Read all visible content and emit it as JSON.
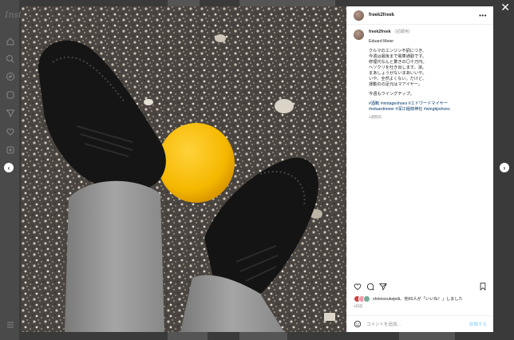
{
  "app": {
    "logo_text": "Inst"
  },
  "post": {
    "username": "freek2freek",
    "more_label": "•••",
    "caption": {
      "username": "freek2freek",
      "edited": "（記録用）",
      "lines": [
        "Eduard Meier",
        "",
        "クルマのエンジン不調につき、",
        "今週は最後まで電車通勤です。",
        "修理代なんと驚きの〇十万円。",
        "ヘソクリを吐き出します。涙。",
        "まあしょうがないまあいいや。",
        "いや、全然よくない。だけど、",
        "運動のの足元はマアイヤー。",
        "",
        "今週もウイングチップ。"
      ],
      "hashtags": [
        "#酒靴 #vintageshoes #エドワードマイヤー",
        "#eduardmeier #深江稲荷神社 #wingtipshoes"
      ],
      "time": "1週間前"
    },
    "likes_text": "shinnosukejedi、他60人が「いいね！」しました",
    "post_time": "3日前",
    "comment_placeholder": "コメントを追加...",
    "post_button": "投稿する"
  },
  "controls": {
    "close": "✕",
    "prev": "‹",
    "next": "›"
  },
  "colors": {
    "accent_link": "#00376b",
    "post_button": "#b2dffc",
    "overlay": "#3a3a3a"
  }
}
